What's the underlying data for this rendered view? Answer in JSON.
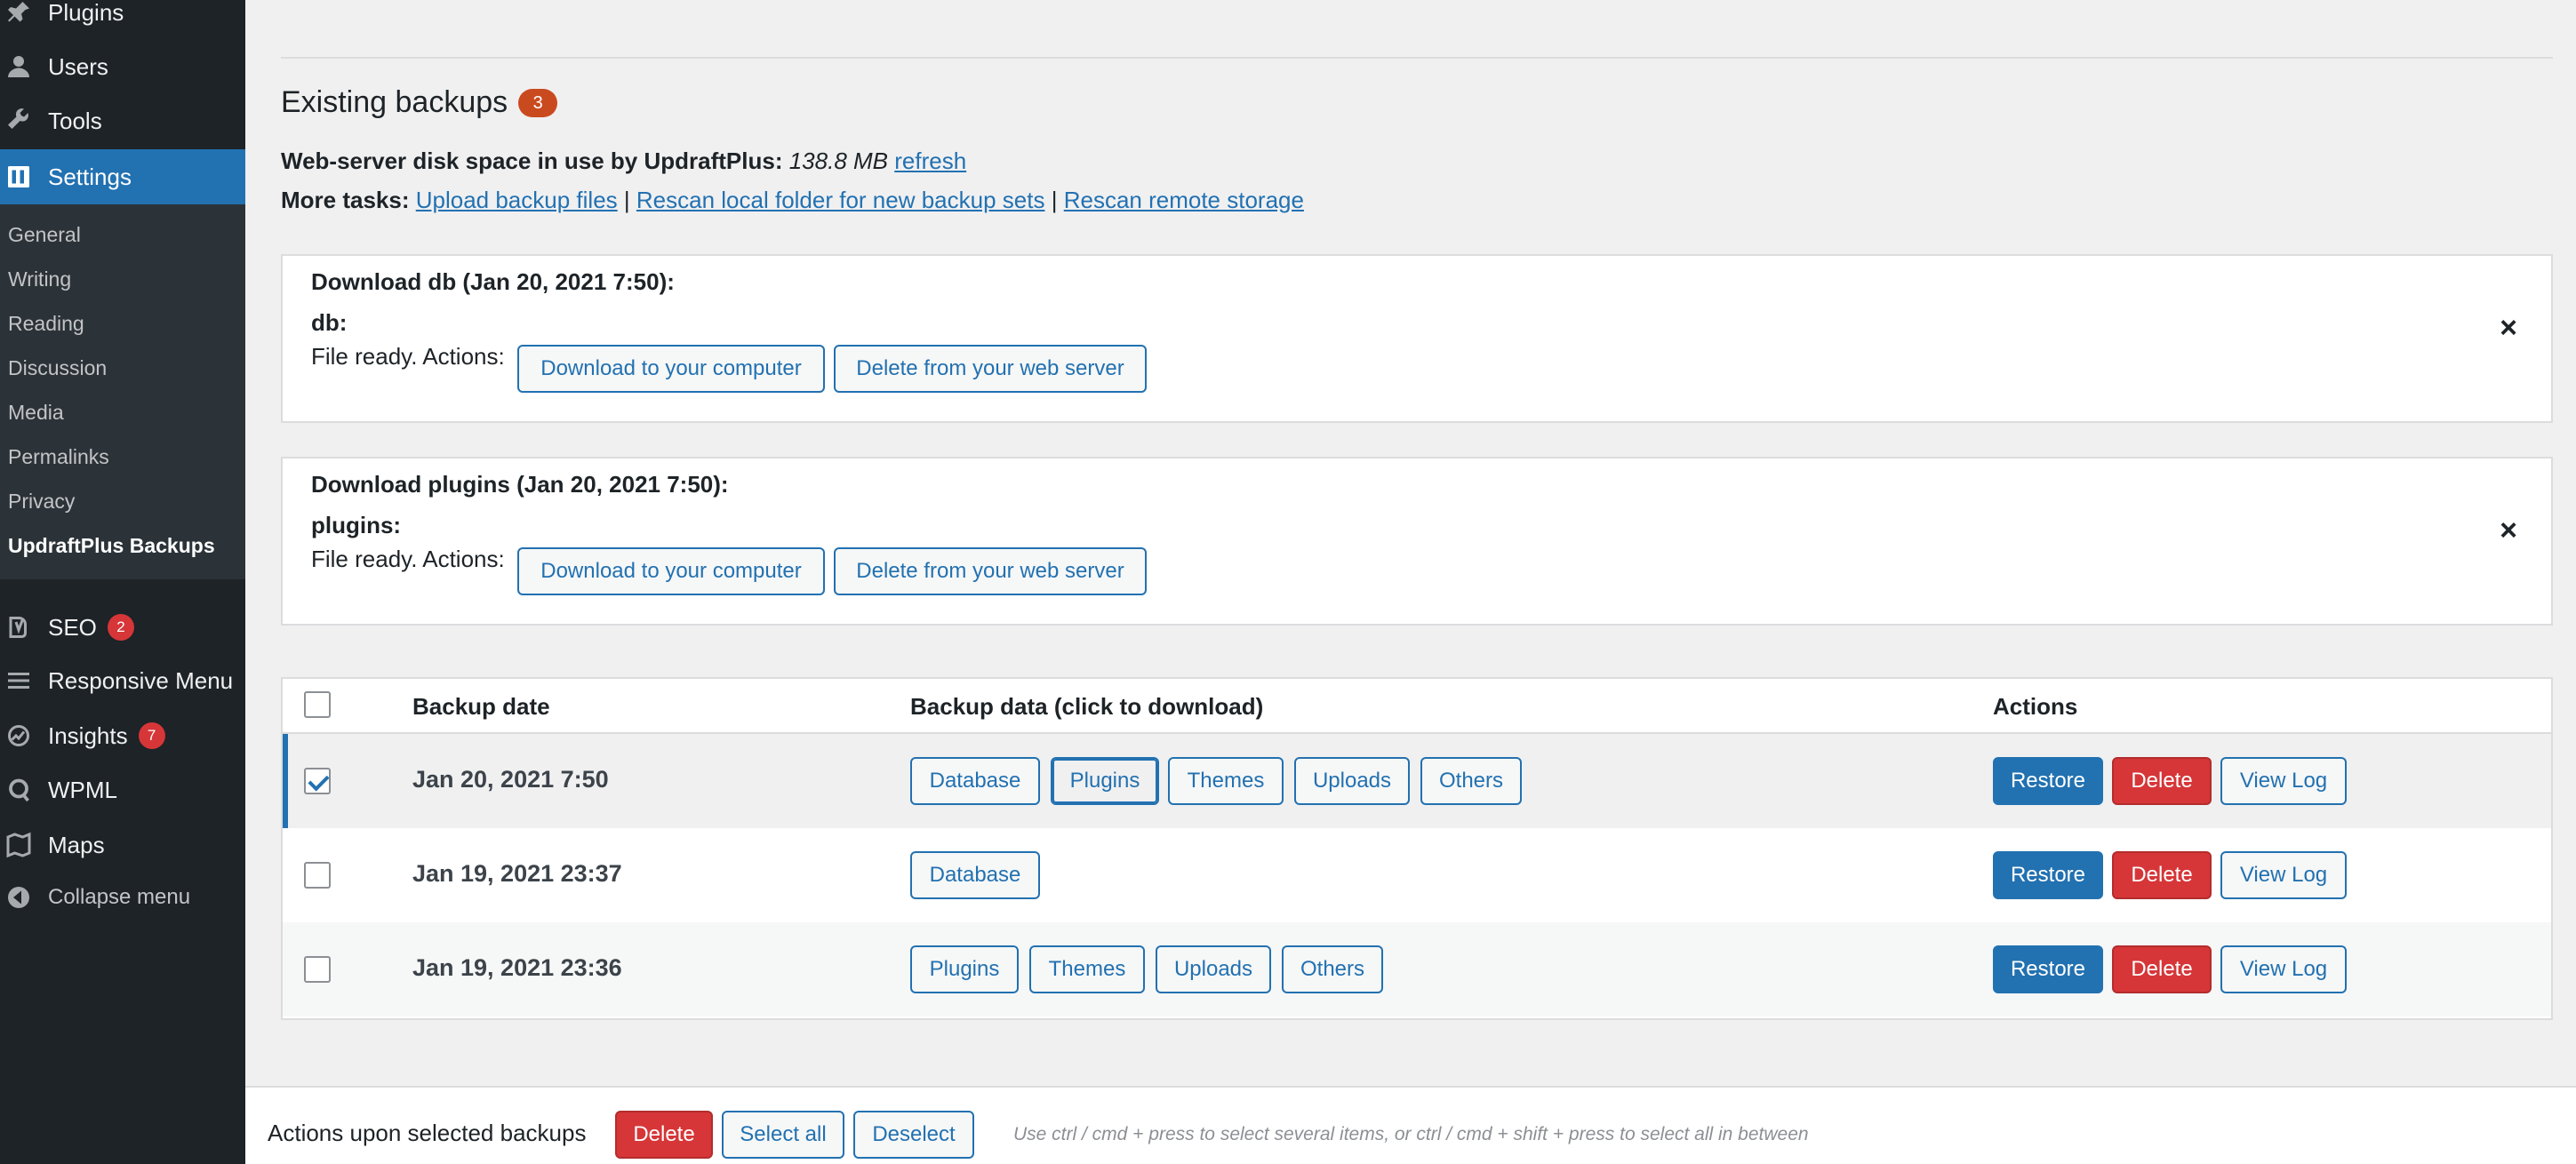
{
  "sidebar": {
    "top_items": [
      {
        "label": "Plugins",
        "icon": "plugin-icon"
      },
      {
        "label": "Users",
        "icon": "users-icon"
      },
      {
        "label": "Tools",
        "icon": "wrench-icon"
      },
      {
        "label": "Settings",
        "icon": "settings-icon"
      }
    ],
    "submenu": [
      {
        "label": "General"
      },
      {
        "label": "Writing"
      },
      {
        "label": "Reading"
      },
      {
        "label": "Discussion"
      },
      {
        "label": "Media"
      },
      {
        "label": "Permalinks"
      },
      {
        "label": "Privacy"
      },
      {
        "label": "UpdraftPlus Backups"
      }
    ],
    "bottom_items": [
      {
        "label": "SEO",
        "badge": "2",
        "icon": "yoast-icon"
      },
      {
        "label": "Responsive Menu",
        "icon": "hamburger-icon"
      },
      {
        "label": "Insights",
        "badge": "7",
        "icon": "insights-icon"
      },
      {
        "label": "WPML",
        "icon": "wpml-icon"
      },
      {
        "label": "Maps",
        "icon": "maps-icon"
      }
    ],
    "collapse_label": "Collapse menu"
  },
  "main": {
    "section_title": "Existing backups",
    "backup_count": "3",
    "disk_label": "Web-server disk space in use by UpdraftPlus:",
    "disk_value": "138.8 MB",
    "refresh_link": "refresh",
    "more_tasks_label": "More tasks:",
    "more_tasks_links": [
      "Upload backup files",
      "Rescan local folder for new backup sets",
      "Rescan remote storage"
    ],
    "separator": "|",
    "downloads": [
      {
        "title": "Download db (Jan 20, 2021 7:50):",
        "name": "db:",
        "ready": "File ready. Actions:",
        "download_label": "Download to your computer",
        "delete_label": "Delete from your web server",
        "close": "×"
      },
      {
        "title": "Download plugins (Jan 20, 2021 7:50):",
        "name": "plugins:",
        "ready": "File ready. Actions:",
        "download_label": "Download to your computer",
        "delete_label": "Delete from your web server",
        "close": "×"
      }
    ],
    "table": {
      "headers": [
        "Backup date",
        "Backup data (click to download)",
        "Actions"
      ],
      "rows": [
        {
          "date": "Jan 20, 2021 7:50",
          "checked": true,
          "data": [
            "Database",
            "Plugins",
            "Themes",
            "Uploads",
            "Others"
          ]
        },
        {
          "date": "Jan 19, 2021 23:37",
          "checked": false,
          "data": [
            "Database"
          ]
        },
        {
          "date": "Jan 19, 2021 23:36",
          "checked": false,
          "data": [
            "Plugins",
            "Themes",
            "Uploads",
            "Others"
          ]
        }
      ],
      "actions": {
        "restore": "Restore",
        "delete": "Delete",
        "view_log": "View Log"
      }
    },
    "bottom_bar": {
      "label": "Actions upon selected backups",
      "delete": "Delete",
      "select_all": "Select all",
      "deselect": "Deselect",
      "hint": "Use ctrl / cmd + press to select several items, or ctrl / cmd + shift + press to select all in between"
    }
  },
  "colors": {
    "sidebar_bg": "#1d2327",
    "accent": "#2271b1",
    "danger": "#d63638",
    "badge": "#ca4a1f"
  }
}
